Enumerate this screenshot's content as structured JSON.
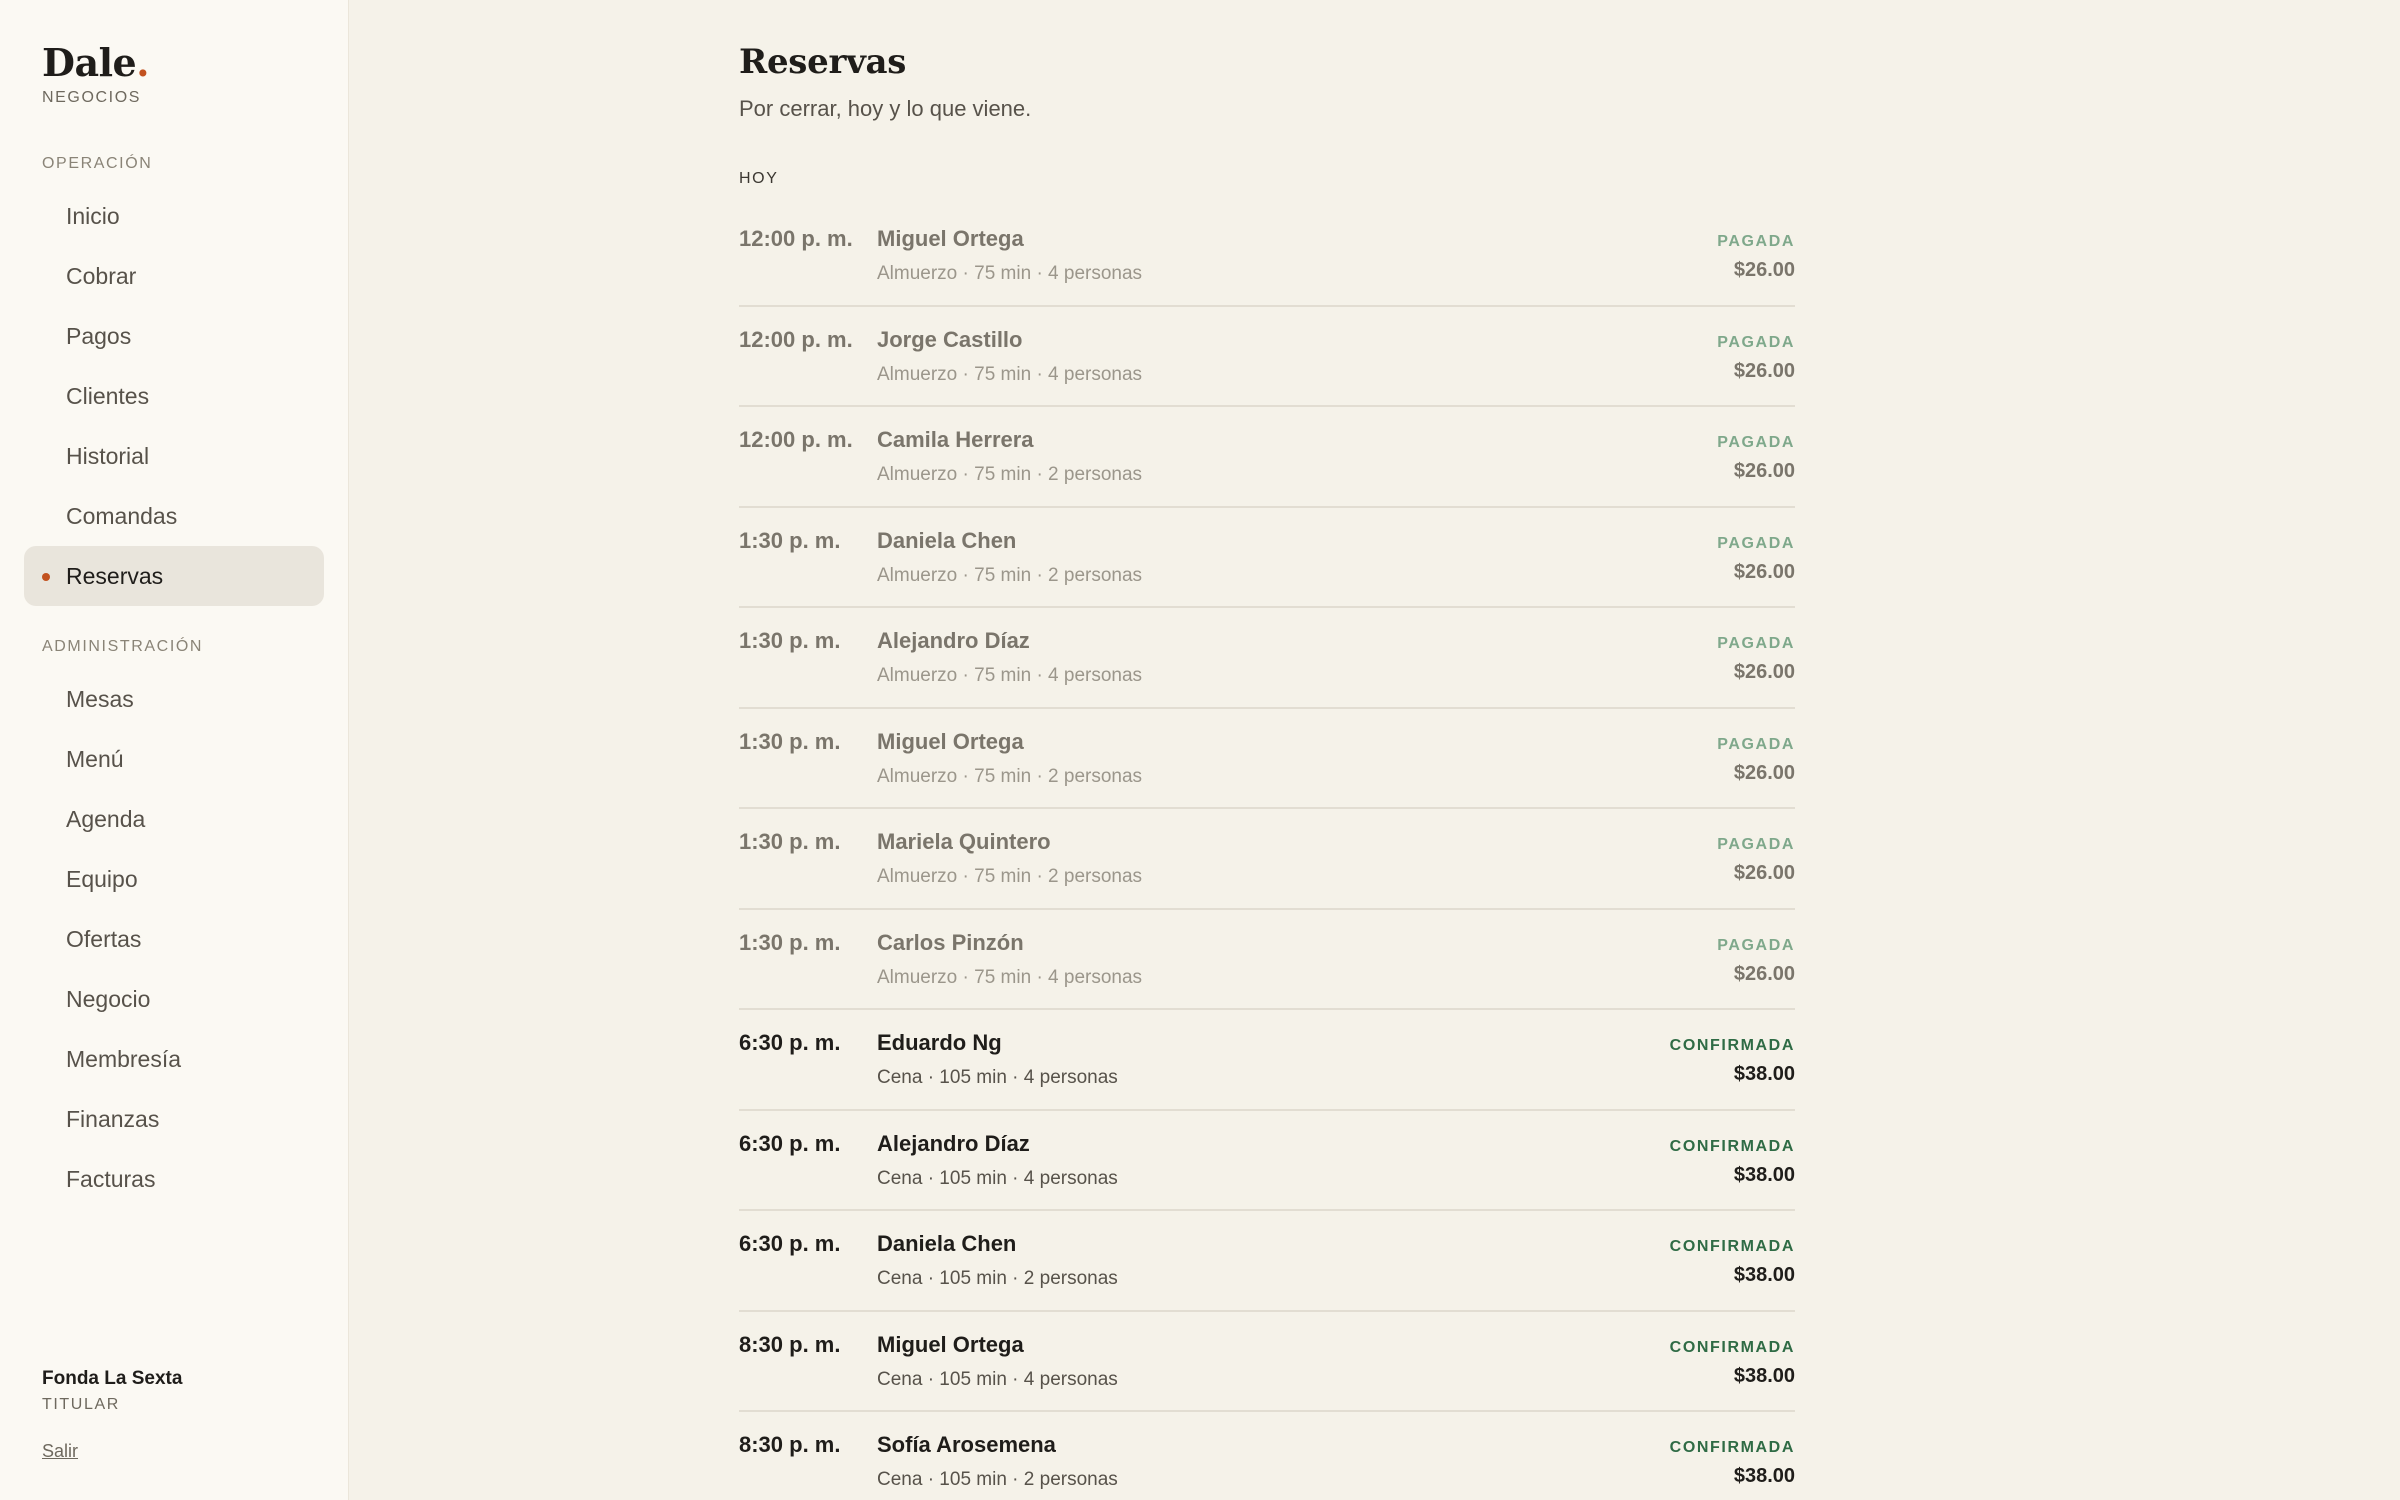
{
  "brand": {
    "name": "Dale",
    "dot": ".",
    "subtitle": "NEGOCIOS"
  },
  "nav": {
    "operacion_label": "OPERACIÓN",
    "operacion_items": [
      {
        "label": "Inicio"
      },
      {
        "label": "Cobrar"
      },
      {
        "label": "Pagos"
      },
      {
        "label": "Clientes"
      },
      {
        "label": "Historial"
      },
      {
        "label": "Comandas"
      },
      {
        "label": "Reservas",
        "active": true
      }
    ],
    "administracion_label": "ADMINISTRACIÓN",
    "administracion_items": [
      {
        "label": "Mesas"
      },
      {
        "label": "Menú"
      },
      {
        "label": "Agenda"
      },
      {
        "label": "Equipo"
      },
      {
        "label": "Ofertas"
      },
      {
        "label": "Negocio"
      },
      {
        "label": "Membresía"
      },
      {
        "label": "Finanzas"
      },
      {
        "label": "Facturas"
      }
    ]
  },
  "account": {
    "name": "Fonda La Sexta",
    "role": "TITULAR",
    "logout_label": "Salir"
  },
  "page": {
    "title": "Reservas",
    "subtitle": "Por cerrar, hoy y lo que viene.",
    "section_label": "HOY"
  },
  "colors": {
    "accent": "#c2521f",
    "status_pagada": "#7fa88b",
    "status_confirmada": "#2f6b45",
    "background": "#f5f2e9",
    "sidebar": "#fbf9f3"
  },
  "reservations": [
    {
      "time": "12:00 p. m.",
      "name": "Miguel Ortega",
      "details": "Almuerzo · 75 min · 4 personas",
      "status": "PAGADA",
      "price": "$26.00",
      "past": true
    },
    {
      "time": "12:00 p. m.",
      "name": "Jorge Castillo",
      "details": "Almuerzo · 75 min · 4 personas",
      "status": "PAGADA",
      "price": "$26.00",
      "past": true
    },
    {
      "time": "12:00 p. m.",
      "name": "Camila Herrera",
      "details": "Almuerzo · 75 min · 2 personas",
      "status": "PAGADA",
      "price": "$26.00",
      "past": true
    },
    {
      "time": "1:30 p. m.",
      "name": "Daniela Chen",
      "details": "Almuerzo · 75 min · 2 personas",
      "status": "PAGADA",
      "price": "$26.00",
      "past": true
    },
    {
      "time": "1:30 p. m.",
      "name": "Alejandro Díaz",
      "details": "Almuerzo · 75 min · 4 personas",
      "status": "PAGADA",
      "price": "$26.00",
      "past": true
    },
    {
      "time": "1:30 p. m.",
      "name": "Miguel Ortega",
      "details": "Almuerzo · 75 min · 2 personas",
      "status": "PAGADA",
      "price": "$26.00",
      "past": true
    },
    {
      "time": "1:30 p. m.",
      "name": "Mariela Quintero",
      "details": "Almuerzo · 75 min · 2 personas",
      "status": "PAGADA",
      "price": "$26.00",
      "past": true
    },
    {
      "time": "1:30 p. m.",
      "name": "Carlos Pinzón",
      "details": "Almuerzo · 75 min · 4 personas",
      "status": "PAGADA",
      "price": "$26.00",
      "past": true
    },
    {
      "time": "6:30 p. m.",
      "name": "Eduardo Ng",
      "details": "Cena · 105 min · 4 personas",
      "status": "CONFIRMADA",
      "price": "$38.00",
      "past": false
    },
    {
      "time": "6:30 p. m.",
      "name": "Alejandro Díaz",
      "details": "Cena · 105 min · 4 personas",
      "status": "CONFIRMADA",
      "price": "$38.00",
      "past": false
    },
    {
      "time": "6:30 p. m.",
      "name": "Daniela Chen",
      "details": "Cena · 105 min · 2 personas",
      "status": "CONFIRMADA",
      "price": "$38.00",
      "past": false
    },
    {
      "time": "8:30 p. m.",
      "name": "Miguel Ortega",
      "details": "Cena · 105 min · 4 personas",
      "status": "CONFIRMADA",
      "price": "$38.00",
      "past": false
    },
    {
      "time": "8:30 p. m.",
      "name": "Sofía Arosemena",
      "details": "Cena · 105 min · 2 personas",
      "status": "CONFIRMADA",
      "price": "$38.00",
      "past": false
    }
  ]
}
